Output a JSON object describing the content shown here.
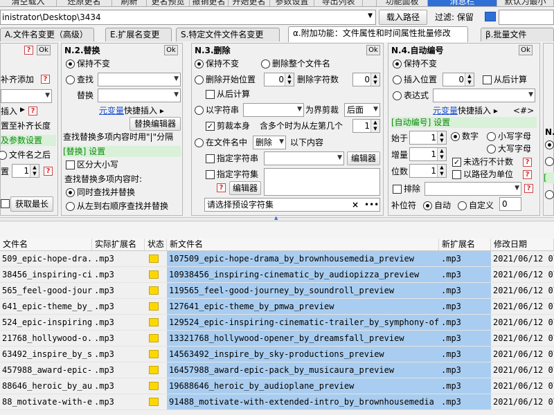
{
  "toolbar": {
    "buttons": [
      "清空载入",
      "还原更名",
      "刷新",
      "更名预览",
      "撤销更名",
      "开始更名",
      "参数设置",
      "导出列表",
      "",
      "功能面板",
      "消息栏",
      "默认为最小"
    ]
  },
  "path_bar": {
    "path": "inistrator\\Desktop\\3434",
    "load_button": "载入路径",
    "filter_label": "过滤: 保留"
  },
  "tabs": [
    {
      "label": "A.文件名变更（高级）"
    },
    {
      "label": "E.扩展名变更"
    },
    {
      "label": "S.特定文件文件名变更"
    },
    {
      "label": "α.附加功能：文件属性和时间属性批量修改"
    },
    {
      "label": "β.批量文件"
    }
  ],
  "panel_left": {
    "pad_label": "补齐添加",
    "insert_label": "插入",
    "pad_length_label": "置至补齐长度",
    "params_label": "及参数设置",
    "after_filename_label": "文件名之后",
    "pos_label": "置",
    "pos_value": "1",
    "get_length_button": "获取最长",
    "ok_label": "Ok",
    "q_label": "?"
  },
  "panel_n2": {
    "title": "N.2.替换",
    "ok_label": "Ok",
    "keep_label": "保持不变",
    "find_label": "查找",
    "replace_label": "替换",
    "meta_link": "元变量",
    "quick_insert_label": "快捷插入 ▸",
    "editor_button": "替换编辑器",
    "note": "查找替换多项内容时用\"|\"分隔",
    "settings_label": "[替换] 设置",
    "case_label": "区分大小写",
    "multi_label": "查找替换多项内容时:",
    "simul_label": "同时查找并替换",
    "seq_label": "从左到右顺序查找并替换"
  },
  "panel_n3": {
    "title": "N.3.删除",
    "ok_label": "Ok",
    "keep_label": "保持不变",
    "delete_whole_label": "删除整个文件名",
    "delete_start_label": "删除开始位置",
    "start_value": "0",
    "delete_count_label": "删除字符数",
    "count_value": "0",
    "from_end_label": "从后计算",
    "by_string_label": "以字符串",
    "boundary_label": "为界剪裁",
    "after_option": "后面",
    "cut_self_label": "剪裁本身",
    "multi_count_label": "含多个时为从左第几个",
    "multi_value": "1",
    "in_filename_label": "在文件名中",
    "delete_option": "删除",
    "following_label": "以下内容",
    "specific_string_label": "指定字符串",
    "specific_set_label": "指定字符集",
    "editor_label": "编辑器",
    "preset_placeholder": "请选择预设字符集",
    "preset_close": "×",
    "preset_more": "•••"
  },
  "panel_n4": {
    "title": "N.4.自动编号",
    "ok_label": "Ok",
    "keep_label": "保持不变",
    "insert_pos_label": "插入位置",
    "insert_value": "0",
    "from_end_label": "从后计算",
    "expr_label": "表达式",
    "meta_link": "元变量",
    "quick_insert_label": "快捷插入 ▸",
    "hash_label": "<#>",
    "settings_label": "[自动编号] 设置",
    "start_label": "始于",
    "start_value": "1",
    "step_label": "增量",
    "step_value": "1",
    "digits_label": "位数",
    "digits_value": "1",
    "number_label": "数字",
    "lower_label": "小写字母",
    "upper_label": "大写字母",
    "skip_label": "未选行不计数",
    "by_path_label": "以路径为单位",
    "exclude_label": "排除",
    "pad_label": "补位符",
    "auto_label": "自动",
    "custom_label": "自定义",
    "custom_value": "0"
  },
  "panel_right": {
    "label": "N."
  },
  "table": {
    "headers": [
      "文件名",
      "实际扩展名",
      "状态",
      "新文件名",
      "新扩展名",
      "修改日期"
    ],
    "rows": [
      {
        "old": "509_epic-hope-dra...",
        "ext": ".mp3",
        "new": "107509_epic-hope-drama_by_brownhousemedia_preview",
        "newext": ".mp3",
        "date": "2021/06/12 07"
      },
      {
        "old": "38456_inspiring-cin...",
        "ext": ".mp3",
        "new": "10938456_inspiring-cinematic_by_audiopizza_preview",
        "newext": ".mp3",
        "date": "2021/06/12 07"
      },
      {
        "old": "565_feel-good-jour...",
        "ext": ".mp3",
        "new": "119565_feel-good-journey_by_soundroll_preview",
        "newext": ".mp3",
        "date": "2021/06/12 07"
      },
      {
        "old": "641_epic-theme_by_...",
        "ext": ".mp3",
        "new": "127641_epic-theme_by_pmwa_preview",
        "newext": ".mp3",
        "date": "2021/06/12 07"
      },
      {
        "old": "524_epic-inspiring-...",
        "ext": ".mp3",
        "new": "129524_epic-inspiring-cinematic-trailer_by_symphony-of-spe...",
        "newext": ".mp3",
        "date": "2021/06/12 07"
      },
      {
        "old": "21768_hollywood-o...",
        "ext": ".mp3",
        "new": "13321768_hollywood-opener_by_dreamsfall_preview",
        "newext": ".mp3",
        "date": "2021/06/12 07"
      },
      {
        "old": "63492_inspire_by_s...",
        "ext": ".mp3",
        "new": "14563492_inspire_by_sky-productions_preview",
        "newext": ".mp3",
        "date": "2021/06/12 07"
      },
      {
        "old": "457988_award-epic-...",
        "ext": ".mp3",
        "new": "16457988_award-epic-pack_by_musicaura_preview",
        "newext": ".mp3",
        "date": "2021/06/12 07"
      },
      {
        "old": "88646_heroic_by_au...",
        "ext": ".mp3",
        "new": "19688646_heroic_by_audioplane_preview",
        "newext": ".mp3",
        "date": "2021/06/12 07"
      },
      {
        "old": "88_motivate-with-ex...",
        "ext": ".mp3",
        "new": "91488_motivate-with-extended-intro_by_brownhousemedia",
        "newext": ".mp3",
        "date": "2021/06/12 07"
      }
    ]
  },
  "colors": {
    "selection": "#a9cdf0",
    "status_icon": "#ffd700",
    "link": "#1a4fd0",
    "green_section": "#0a8a0a"
  }
}
